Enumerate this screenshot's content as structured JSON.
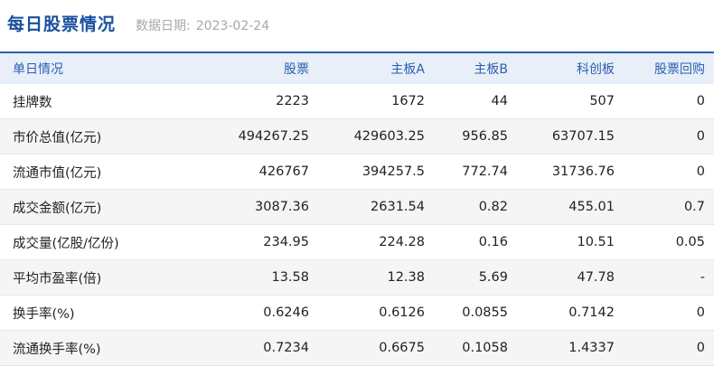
{
  "header": {
    "title": "每日股票情况",
    "date_label": "数据日期:",
    "date_value": "2023-02-24"
  },
  "table": {
    "columns": [
      "单日情况",
      "股票",
      "主板A",
      "主板B",
      "科创板",
      "股票回购"
    ],
    "rows": [
      {
        "label": "挂牌数",
        "values": [
          "2223",
          "1672",
          "44",
          "507",
          "0"
        ]
      },
      {
        "label": "市价总值(亿元)",
        "values": [
          "494267.25",
          "429603.25",
          "956.85",
          "63707.15",
          "0"
        ]
      },
      {
        "label": "流通市值(亿元)",
        "values": [
          "426767",
          "394257.5",
          "772.74",
          "31736.76",
          "0"
        ]
      },
      {
        "label": "成交金额(亿元)",
        "values": [
          "3087.36",
          "2631.54",
          "0.82",
          "455.01",
          "0.7"
        ]
      },
      {
        "label": "成交量(亿股/亿份)",
        "values": [
          "234.95",
          "224.28",
          "0.16",
          "10.51",
          "0.05"
        ]
      },
      {
        "label": "平均市盈率(倍)",
        "values": [
          "13.58",
          "12.38",
          "5.69",
          "47.78",
          "-"
        ]
      },
      {
        "label": "换手率(%)",
        "values": [
          "0.6246",
          "0.6126",
          "0.0855",
          "0.7142",
          "0"
        ]
      },
      {
        "label": "流通换手率(%)",
        "values": [
          "0.7234",
          "0.6675",
          "0.1058",
          "1.4337",
          "0"
        ]
      }
    ]
  },
  "colors": {
    "title": "#1a4fa0",
    "header_text": "#2a5fb0",
    "header_bg": "#e8eff9",
    "row_shade": "#f5f5f5"
  }
}
